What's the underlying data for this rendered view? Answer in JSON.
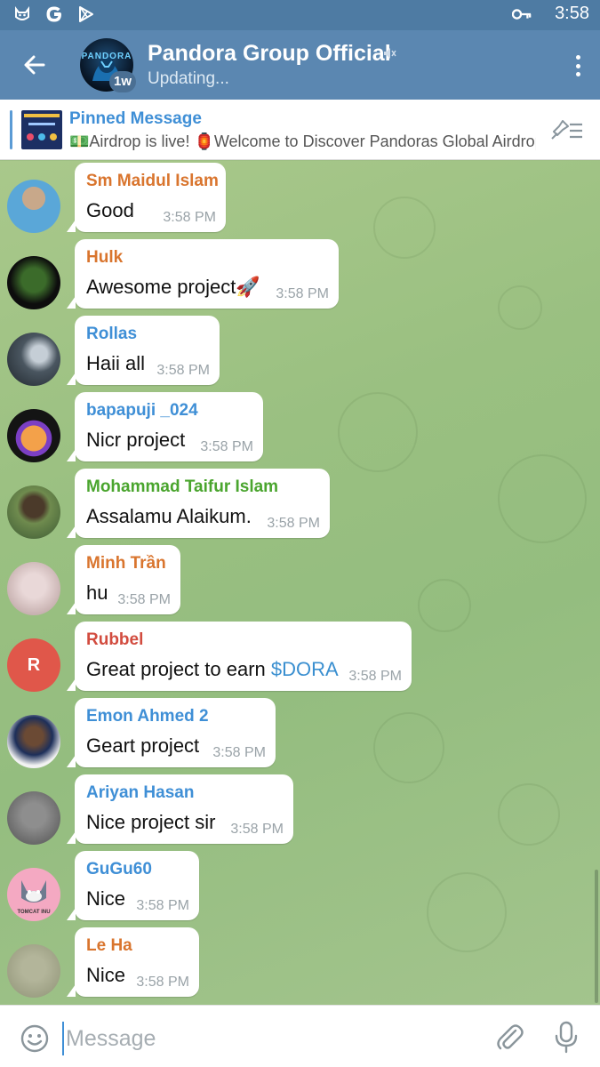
{
  "status_bar": {
    "time": "3:58",
    "left_icons": [
      "cat-face-icon",
      "google-g-icon",
      "play-store-icon"
    ],
    "right_icons": [
      "key-icon"
    ]
  },
  "header": {
    "back_icon": "arrow-left-icon",
    "avatar_logo": "PANDORA",
    "badge": "1w",
    "title": "Pandora Group Official",
    "muted_icon": "mute-icon",
    "status": "Updating...",
    "menu_icon": "more-vert-icon",
    "colors": {
      "bar": "#5b87b1",
      "status_bar": "#4e7ba3"
    }
  },
  "pinned": {
    "title": "Pinned Message",
    "text": "💵Airdrop is live!  🏮Welcome to Discover Pandoras Global Airdrop",
    "action_icon": "pin-list-icon"
  },
  "messages": [
    {
      "sender": "Sm Maidul Islam",
      "sender_color": "#d9752e",
      "text": "Good",
      "time": "3:58 PM",
      "avatar": "photo"
    },
    {
      "sender": "Hulk",
      "sender_color": "#d9752e",
      "text": "Awesome project🚀",
      "time": "3:58 PM",
      "avatar": "photo"
    },
    {
      "sender": "Rollas",
      "sender_color": "#3f8fd6",
      "text": "Haii all",
      "time": "3:58 PM",
      "avatar": "photo"
    },
    {
      "sender": "bapapuji _024",
      "sender_color": "#3f8fd6",
      "text": "Nicr project",
      "time": "3:58 PM",
      "avatar": "photo"
    },
    {
      "sender": "Mohammad Taifur Islam",
      "sender_color": "#4aa52e",
      "text": "Assalamu Alaikum.",
      "time": "3:58 PM",
      "avatar": "photo"
    },
    {
      "sender": "Minh Trần",
      "sender_color": "#d9752e",
      "text": "hu",
      "time": "3:58 PM",
      "avatar": "photo"
    },
    {
      "sender": "Rubbel",
      "sender_color": "#d24c3f",
      "text_prefix": "Great project to earn ",
      "mention": "$DORA",
      "time": "3:58 PM",
      "avatar": "initial",
      "initial": "R"
    },
    {
      "sender": "Emon Ahmed 2",
      "sender_color": "#3f8fd6",
      "text": "Geart project",
      "time": "3:58 PM",
      "avatar": "photo"
    },
    {
      "sender": "Ariyan Hasan",
      "sender_color": "#3f8fd6",
      "text": "Nice project sir",
      "time": "3:58 PM",
      "avatar": "photo"
    },
    {
      "sender": "GuGu60",
      "sender_color": "#3f8fd6",
      "text": "Nice",
      "time": "3:58 PM",
      "avatar": "photo",
      "avatar_caption": "TOMCAT INU"
    },
    {
      "sender": "Le Ha",
      "sender_color": "#d9752e",
      "text": "Nice",
      "time": "3:58 PM",
      "avatar": "photo"
    }
  ],
  "input": {
    "placeholder": "Message",
    "emoji_icon": "smiley-icon",
    "attach_icon": "paperclip-icon",
    "mic_icon": "microphone-icon"
  }
}
